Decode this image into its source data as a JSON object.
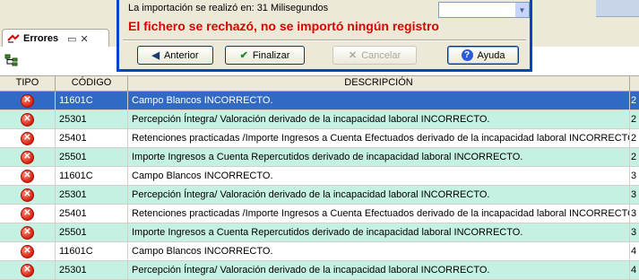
{
  "dialog": {
    "import_time_text": "La importación se realizó en: 31 Milisegundos",
    "error_message": "El fichero se rechazó, no se importó ningún registro",
    "buttons": {
      "back": "Anterior",
      "finish": "Finalizar",
      "cancel": "Cancelar",
      "help": "Ayuda"
    }
  },
  "tab": {
    "label": "Errores"
  },
  "table": {
    "columns": {
      "tipo": "TIPO",
      "codigo": "CÓDIGO",
      "descripcion": "DESCRIPCIÓN"
    },
    "rows": [
      {
        "codigo": "11601C",
        "descripcion": "Campo  Blancos INCORRECTO.",
        "extra": "2",
        "style": "sel"
      },
      {
        "codigo": "25301",
        "descripcion": "Percepción Íntegra/ Valoración derivado de la incapacidad laboral INCORRECTO.",
        "extra": "2",
        "style": "alt"
      },
      {
        "codigo": "25401",
        "descripcion": "Retenciones practicadas /Importe Ingresos a Cuenta Efectuados derivado de la incapacidad laboral INCORRECTO.",
        "extra": "2",
        "style": "white"
      },
      {
        "codigo": "25501",
        "descripcion": "Importe Ingresos a Cuenta Repercutidos derivado de incapacidad laboral INCORRECTO.",
        "extra": "2",
        "style": "alt"
      },
      {
        "codigo": "11601C",
        "descripcion": "Campo  Blancos INCORRECTO.",
        "extra": "3",
        "style": "white"
      },
      {
        "codigo": "25301",
        "descripcion": "Percepción Íntegra/ Valoración derivado de la incapacidad laboral INCORRECTO.",
        "extra": "3",
        "style": "alt"
      },
      {
        "codigo": "25401",
        "descripcion": "Retenciones practicadas /Importe Ingresos a Cuenta Efectuados derivado de la incapacidad laboral INCORRECTO.",
        "extra": "3",
        "style": "white"
      },
      {
        "codigo": "25501",
        "descripcion": "Importe Ingresos a Cuenta Repercutidos derivado de incapacidad laboral INCORRECTO.",
        "extra": "3",
        "style": "alt"
      },
      {
        "codigo": "11601C",
        "descripcion": "Campo  Blancos INCORRECTO.",
        "extra": "4",
        "style": "white"
      },
      {
        "codigo": "25301",
        "descripcion": "Percepción Íntegra/ Valoración derivado de la incapacidad laboral INCORRECTO.",
        "extra": "4",
        "style": "alt"
      }
    ]
  },
  "colors": {
    "selected_row": "#316ac5",
    "alt_row": "#c4f1e1",
    "error_text": "#e00000",
    "dialog_border": "#0b40c8"
  }
}
